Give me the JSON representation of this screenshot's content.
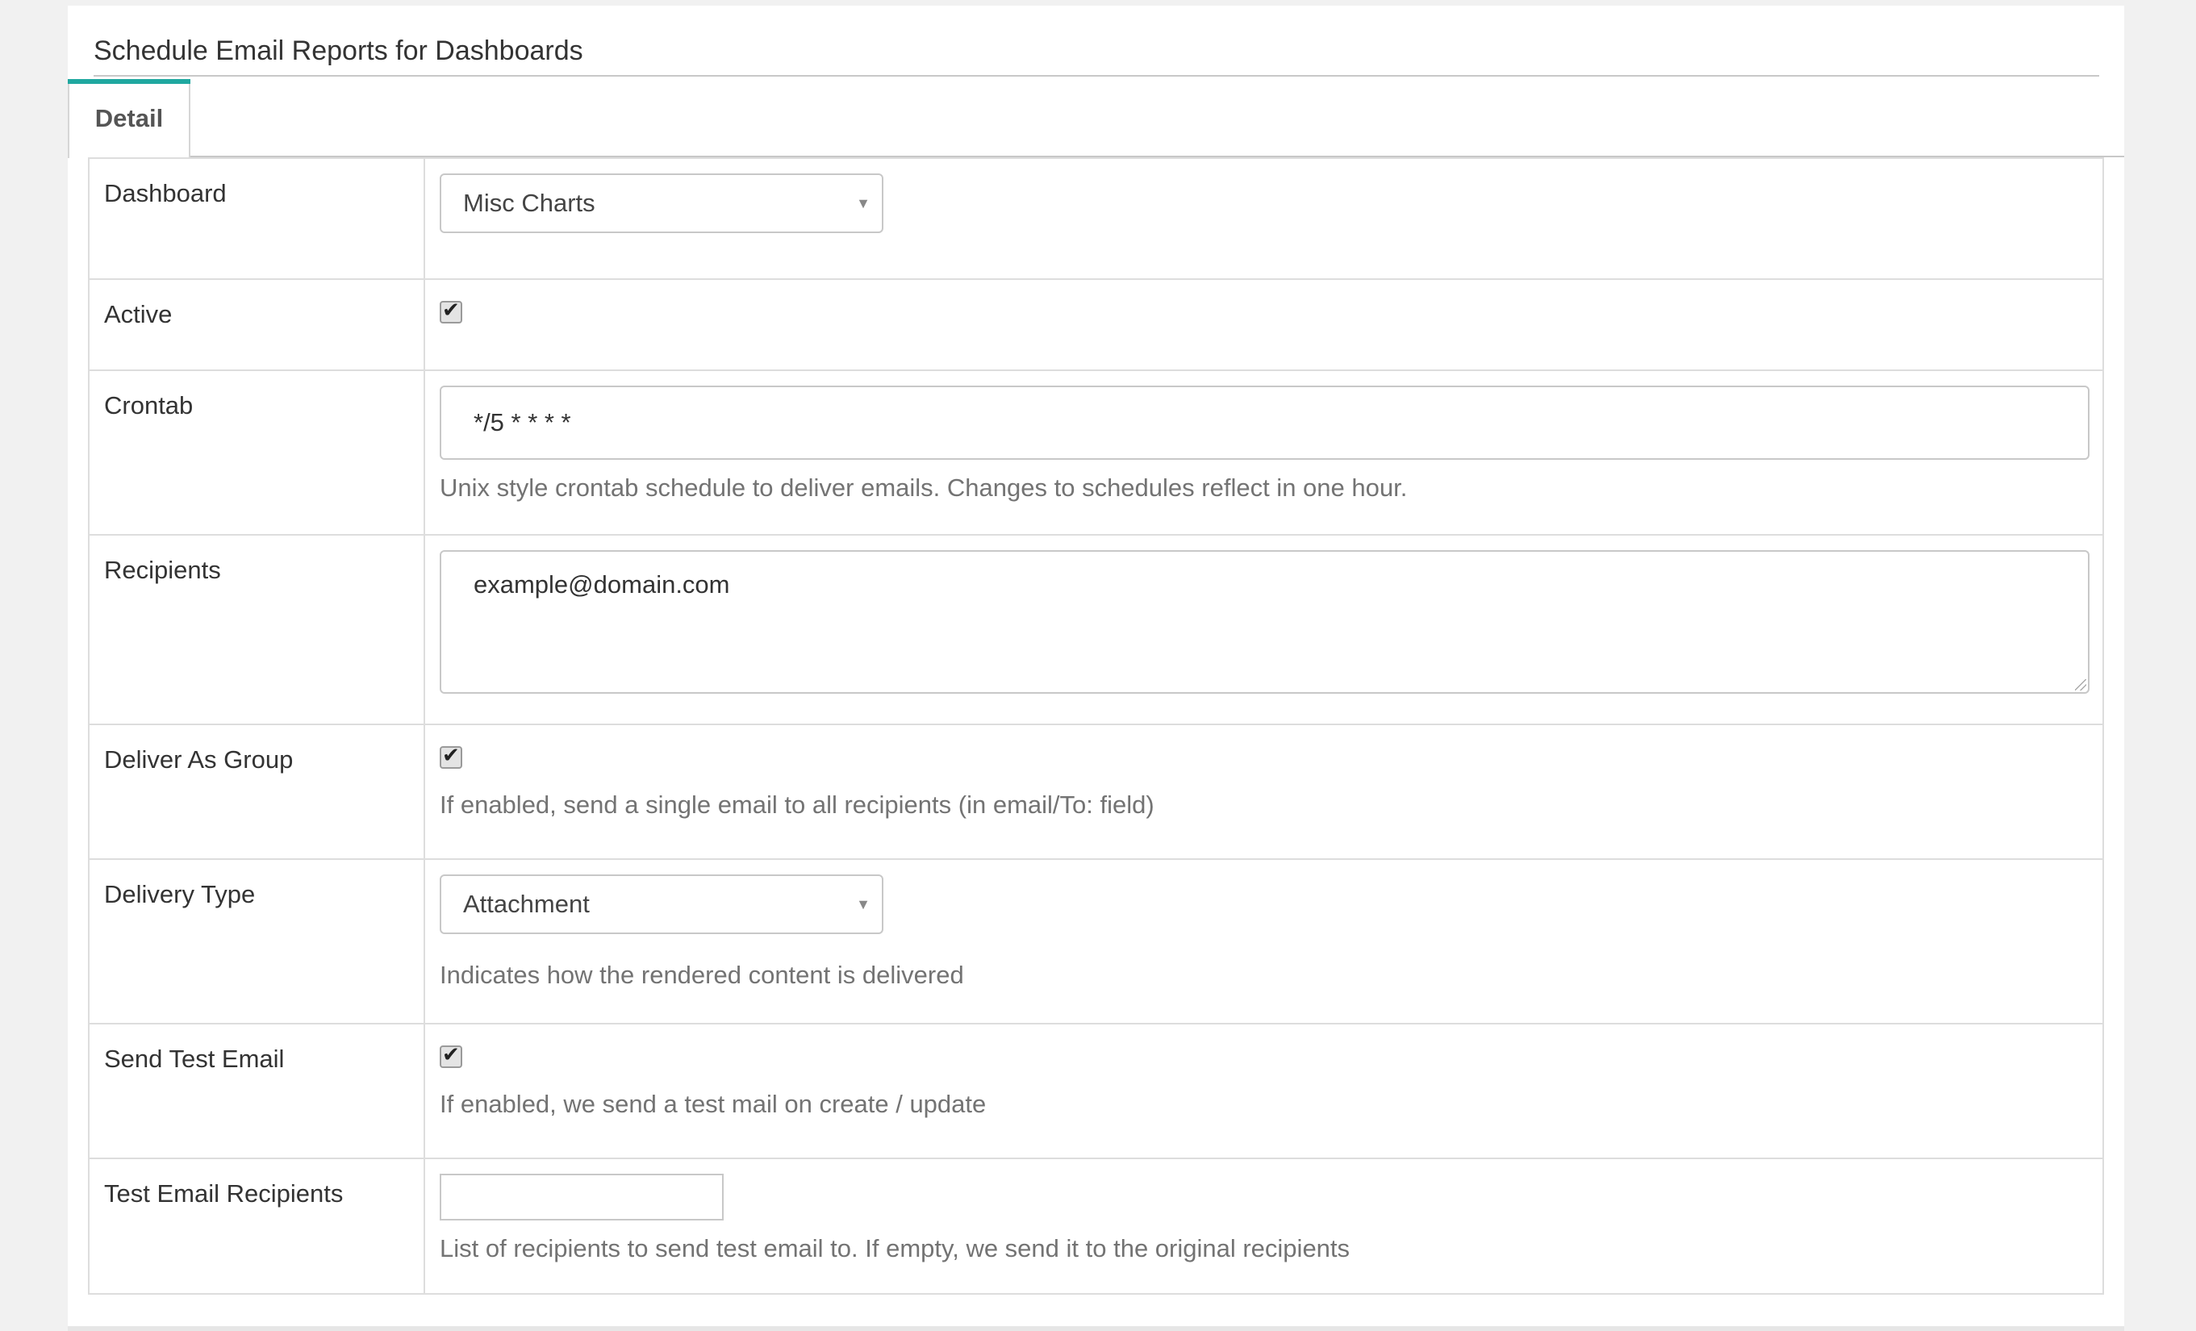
{
  "panel": {
    "title": "Schedule Email Reports for Dashboards"
  },
  "tabs": [
    {
      "label": "Detail",
      "active": true
    }
  ],
  "form": {
    "dashboard": {
      "label": "Dashboard",
      "value": "Misc Charts"
    },
    "active": {
      "label": "Active",
      "checked": true
    },
    "crontab": {
      "label": "Crontab",
      "value": "*/5 * * * *",
      "help": "Unix style crontab schedule to deliver emails. Changes to schedules reflect in one hour."
    },
    "recipients": {
      "label": "Recipients",
      "value": "example@domain.com"
    },
    "deliver_as_group": {
      "label": "Deliver As Group",
      "checked": true,
      "help": "If enabled, send a single email to all recipients (in email/To: field)"
    },
    "delivery_type": {
      "label": "Delivery Type",
      "value": "Attachment",
      "help": "Indicates how the rendered content is delivered"
    },
    "send_test_email": {
      "label": "Send Test Email",
      "checked": true,
      "help": "If enabled, we send a test mail on create / update"
    },
    "test_email_recipients": {
      "label": "Test Email Recipients",
      "value": "",
      "help": "List of recipients to send test email to. If empty, we send it to the original recipients"
    }
  },
  "icons": {
    "select_caret": "caret-down-icon",
    "checkbox": "checkmark-icon",
    "resize": "resize-grip-icon"
  },
  "colors": {
    "accent": "#20a8a0",
    "border": "#dddddd",
    "help_text": "#737373"
  }
}
